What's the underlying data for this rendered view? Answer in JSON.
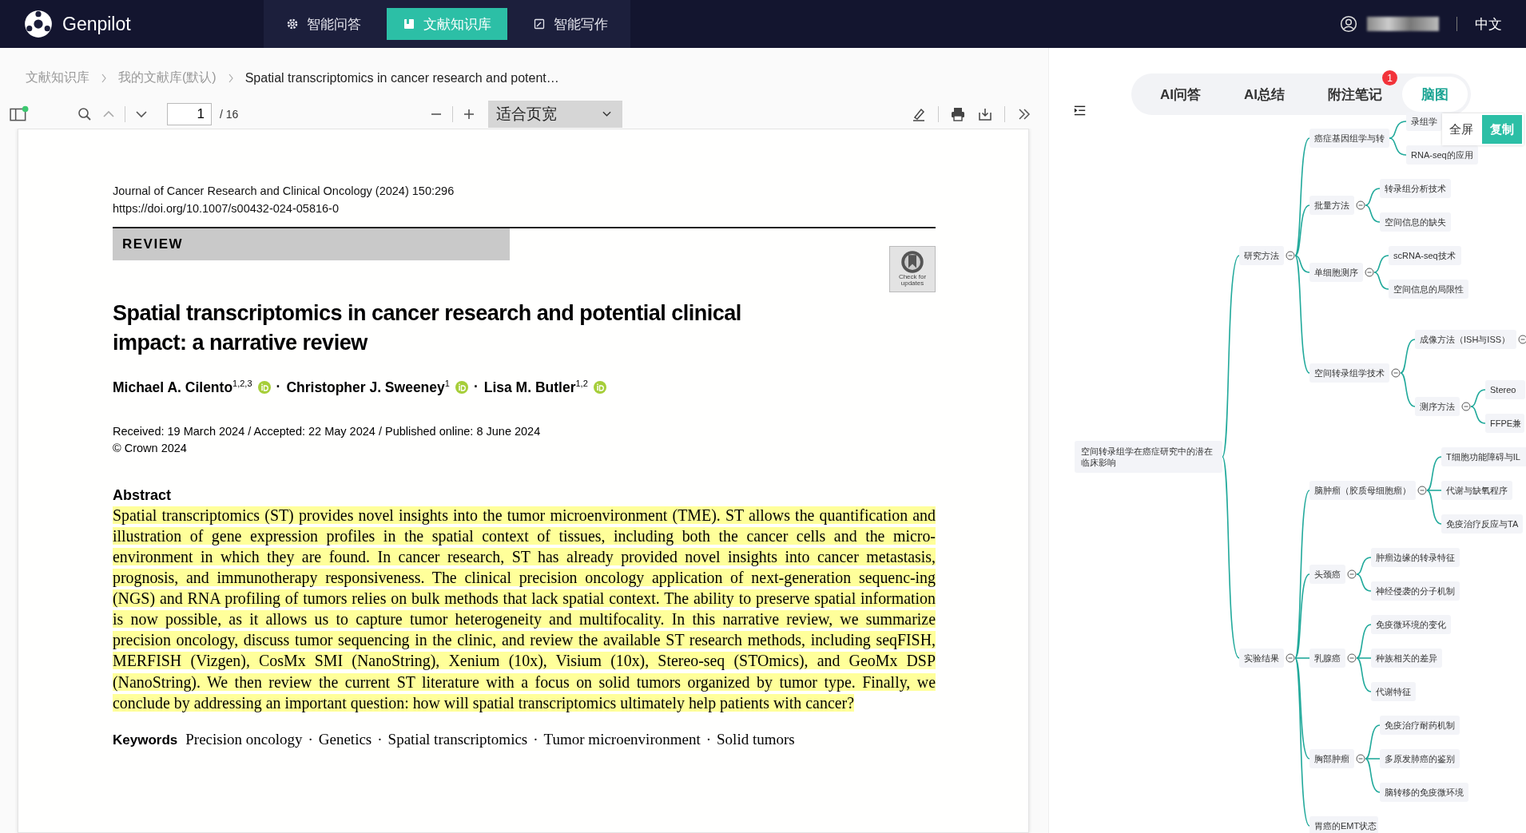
{
  "app": {
    "name": "Genpilot"
  },
  "nav": [
    {
      "label": "智能问答",
      "selected": false
    },
    {
      "label": "文献知识库",
      "selected": true
    },
    {
      "label": "智能写作",
      "selected": false
    }
  ],
  "user": {
    "language": "中文"
  },
  "breadcrumb": [
    "文献知识库",
    "我的文献库(默认)",
    "Spatial transcriptomics in cancer research and potent…"
  ],
  "toolbar": {
    "page": "1",
    "total": "/ 16",
    "zoom": "适合页宽"
  },
  "document": {
    "journal": "Journal of Cancer Research and Clinical Oncology (2024) 150:296",
    "doi": "https://doi.org/10.1007/s00432-024-05816-0",
    "type": "REVIEW",
    "badge": "Check for updates",
    "title": "Spatial transcriptomics in cancer research and potential clinical impact: a narrative review",
    "authors": [
      {
        "name": "Michael A. Cilento$^{1,2,3}$"
      },
      {
        "name": "Christopher J. Sweeney$^{1}$"
      },
      {
        "name": "Lisa M. Butler$^{1,2}$"
      }
    ],
    "author_separator": "·",
    "dates": "Received: 19 March 2024 / Accepted: 22 May 2024 / Published online: 8 June 2024",
    "copyright": "© Crown 2024",
    "abstract_heading": "Abstract",
    "abstract_highlighted": true,
    "abstract": "Spatial transcriptomics (ST) provides novel insights into the tumor microenvironment (TME). ST allows the quantification and illustration of gene expression profiles in the spatial context of tissues, including both the cancer cells and the micro-environment in which they are found. In cancer research, ST has already provided novel insights into cancer metastasis, prognosis, and immunotherapy responsiveness. The clinical precision oncology application of next-generation sequenc-ing (NGS) and RNA profiling of tumors relies on bulk methods that lack spatial context. The ability to preserve spatial information is now possible, as it allows us to capture tumor heterogeneity and multifocality. In this narrative review, we summarize precision oncology, discuss tumor sequencing in the clinic, and review the available ST research methods, including seqFISH, MERFISH (Vizgen), CosMx SMI (NanoString), Xenium (10x), Visium (10x), Stereo-seq (STOmics), and GeoMx DSP (NanoString). We then review the current ST literature with a focus on solid tumors organized by tumor type. Finally, we conclude by addressing an important question: how will spatial transcriptomics ultimately help patients with cancer?",
    "keywords_label": "Keywords",
    "keyword_separator": "·",
    "keywords": [
      "Precision oncology",
      "Genetics",
      "Spatial transcriptomics",
      "Tumor microenvironment",
      "Solid tumors"
    ]
  },
  "panel": {
    "tabs": [
      {
        "label": "AI问答",
        "selected": false
      },
      {
        "label": "AI总结",
        "selected": false
      },
      {
        "label": "附注笔记",
        "badge": "1",
        "selected": false
      },
      {
        "label": "脑图",
        "selected": true
      }
    ],
    "actions": [
      "全屏",
      "复制"
    ],
    "mindmap": {
      "text": "空间转录组学在癌症研究中的潜在临床影响",
      "toggle": false,
      "children": [
        {
          "text": "研究方法",
          "toggle": true,
          "children": [
            {
              "text": "癌症基因组学与转",
              "toggle": false,
              "children": [
                {
                  "text": "录组学",
                  "toggle": false
                },
                {
                  "text": "RNA-seq的应用",
                  "toggle": false
                }
              ]
            },
            {
              "text": "批量方法",
              "toggle": true,
              "children": [
                {
                  "text": "转录组分析技术",
                  "toggle": false
                },
                {
                  "text": "空间信息的缺失",
                  "toggle": false
                }
              ]
            },
            {
              "text": "单细胞测序",
              "toggle": true,
              "children": [
                {
                  "text": "scRNA-seq技术",
                  "toggle": false
                },
                {
                  "text": "空间信息的局限性",
                  "toggle": false
                }
              ]
            },
            {
              "text": "空间转录组学技术",
              "toggle": true,
              "children": [
                {
                  "text": "成像方法（ISH与ISS）",
                  "toggle": true
                },
                {
                  "text": "测序方法",
                  "toggle": true,
                  "children": [
                    {
                      "text": "Stereo",
                      "toggle": false
                    },
                    {
                      "text": "FFPE兼",
                      "toggle": false
                    }
                  ]
                }
              ]
            }
          ]
        },
        {
          "text": "实验结果",
          "toggle": true,
          "children": [
            {
              "text": "脑肿瘤（胶质母细胞瘤）",
              "toggle": true,
              "children": [
                {
                  "text": "T细胞功能障碍与IL",
                  "toggle": false
                },
                {
                  "text": "代谢与缺氧程序",
                  "toggle": false
                },
                {
                  "text": "免疫治疗反应与TA",
                  "toggle": false
                }
              ]
            },
            {
              "text": "头颈癌",
              "toggle": true,
              "children": [
                {
                  "text": "肿瘤边缘的转录特征",
                  "toggle": false
                },
                {
                  "text": "神经侵袭的分子机制",
                  "toggle": false
                }
              ]
            },
            {
              "text": "乳腺癌",
              "toggle": true,
              "children": [
                {
                  "text": "免疫微环境的变化",
                  "toggle": false
                },
                {
                  "text": "种族相关的差异",
                  "toggle": false
                },
                {
                  "text": "代谢特征",
                  "toggle": false
                }
              ]
            },
            {
              "text": "胸部肿瘤",
              "toggle": true,
              "children": [
                {
                  "text": "免疫治疗耐药机制",
                  "toggle": false
                },
                {
                  "text": "多原发肺癌的鉴别",
                  "toggle": false
                },
                {
                  "text": "脑转移的免疫微环境",
                  "toggle": false
                }
              ]
            },
            {
              "text": "胃癌的EMT状态",
              "toggle": false
            }
          ]
        }
      ]
    }
  }
}
